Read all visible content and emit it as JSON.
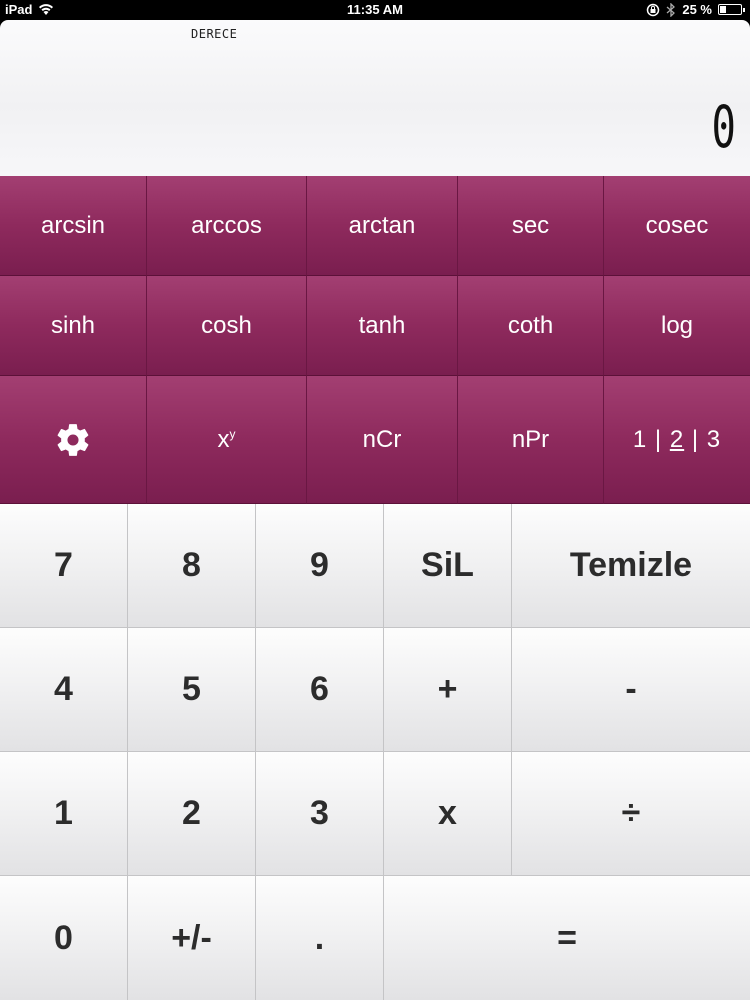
{
  "status_bar": {
    "device": "iPad",
    "time": "11:35 AM",
    "battery_text": "25 %",
    "battery_level": 0.25
  },
  "display": {
    "mode": "DERECE",
    "value": "0"
  },
  "scientific": {
    "row1": [
      "arcsin",
      "arccos",
      "arctan",
      "sec",
      "cosec"
    ],
    "row2": [
      "sinh",
      "cosh",
      "tanh",
      "coth",
      "log"
    ],
    "row3": {
      "power_base": "x",
      "power_exp": "y",
      "ncr": "nCr",
      "npr": "nPr",
      "page_1": "1",
      "page_sep": "|",
      "page_2": "2",
      "page_3": "3"
    }
  },
  "pad": {
    "seven": "7",
    "eight": "8",
    "nine": "9",
    "delete": "SiL",
    "clear": "Temizle",
    "four": "4",
    "five": "5",
    "six": "6",
    "plus": "+",
    "minus": "-",
    "one": "1",
    "two": "2",
    "three": "3",
    "multiply": "x",
    "divide": "÷",
    "zero": "0",
    "sign": "+/-",
    "decimal": ".",
    "equals": "="
  }
}
